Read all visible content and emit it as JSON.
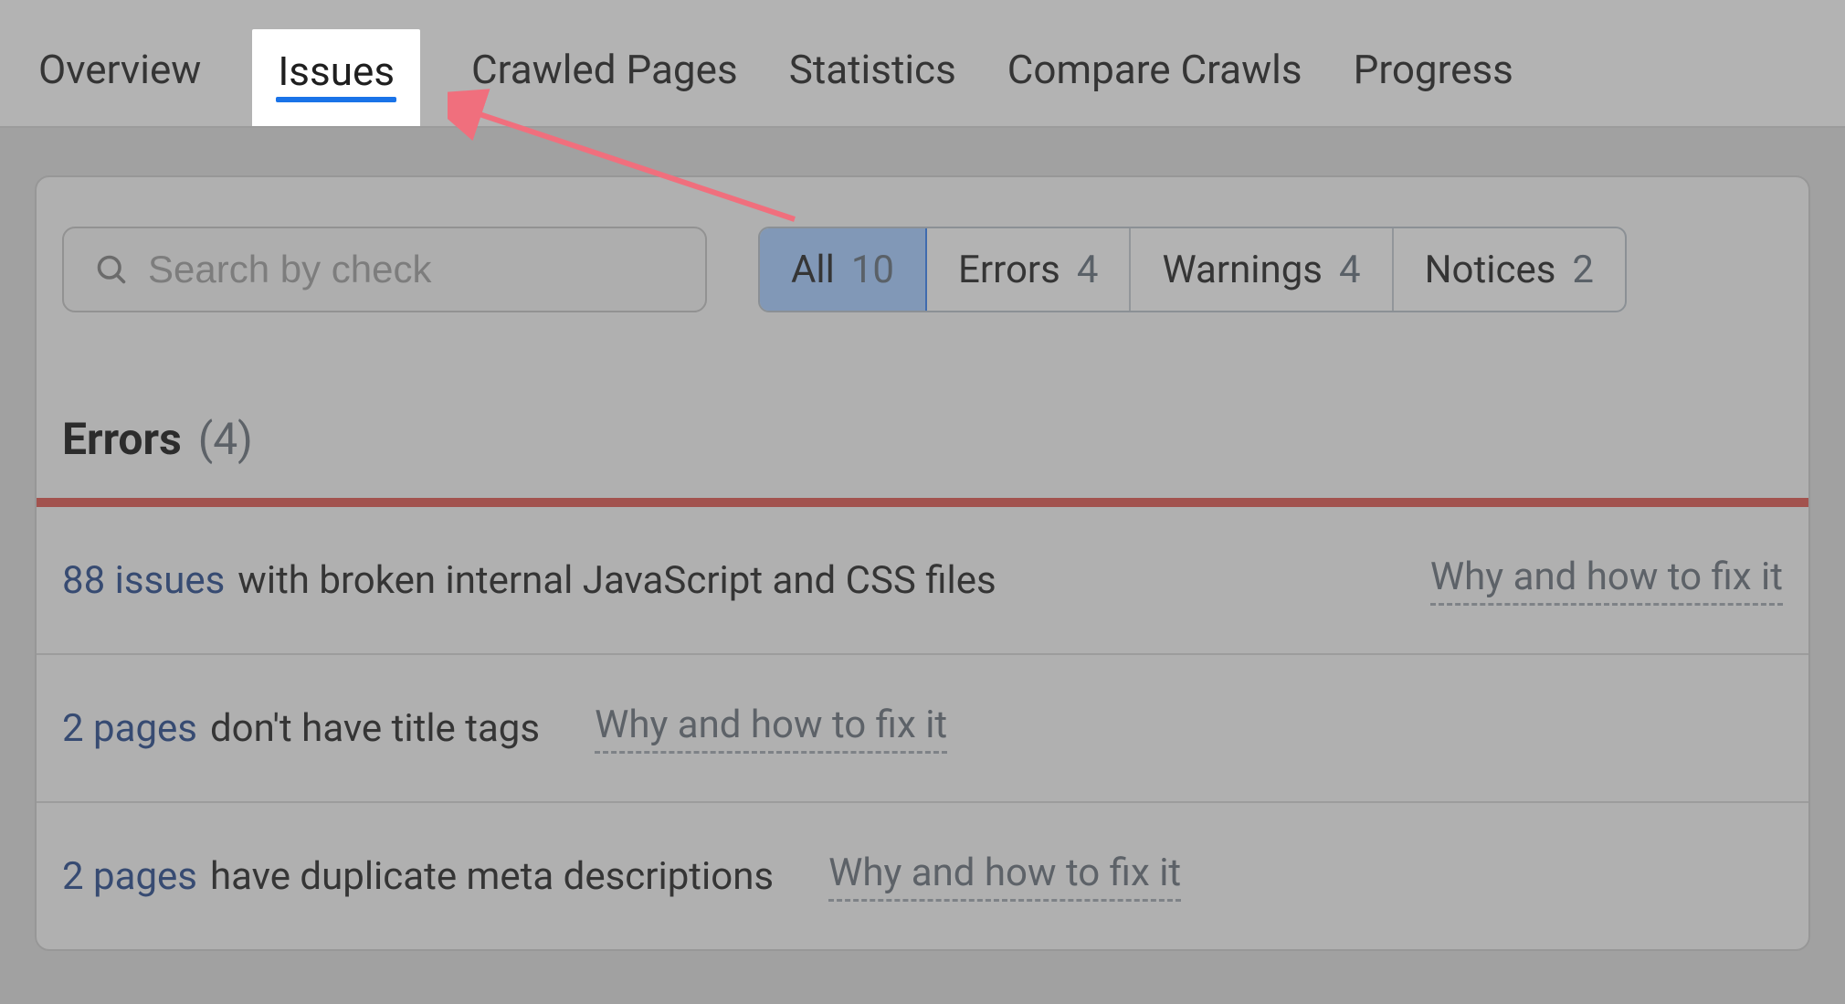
{
  "tabs": {
    "overview": "Overview",
    "issues": "Issues",
    "crawled_pages": "Crawled Pages",
    "statistics": "Statistics",
    "compare_crawls": "Compare Crawls",
    "progress": "Progress",
    "active": "issues"
  },
  "search": {
    "placeholder": "Search by check",
    "value": ""
  },
  "filters": {
    "all": {
      "label": "All",
      "count": "10"
    },
    "errors": {
      "label": "Errors",
      "count": "4"
    },
    "warnings": {
      "label": "Warnings",
      "count": "4"
    },
    "notices": {
      "label": "Notices",
      "count": "2"
    },
    "active": "all"
  },
  "section": {
    "title": "Errors",
    "count_display": "(4)"
  },
  "fix_link_label": "Why and how to fix it",
  "issues": [
    {
      "link": "88 issues",
      "rest": "with broken internal JavaScript and CSS files"
    },
    {
      "link": "2 pages",
      "rest": "don't have title tags"
    },
    {
      "link": "2 pages",
      "rest": "have duplicate meta descriptions"
    }
  ],
  "annotation": {
    "arrow_color": "#f06f7d"
  }
}
